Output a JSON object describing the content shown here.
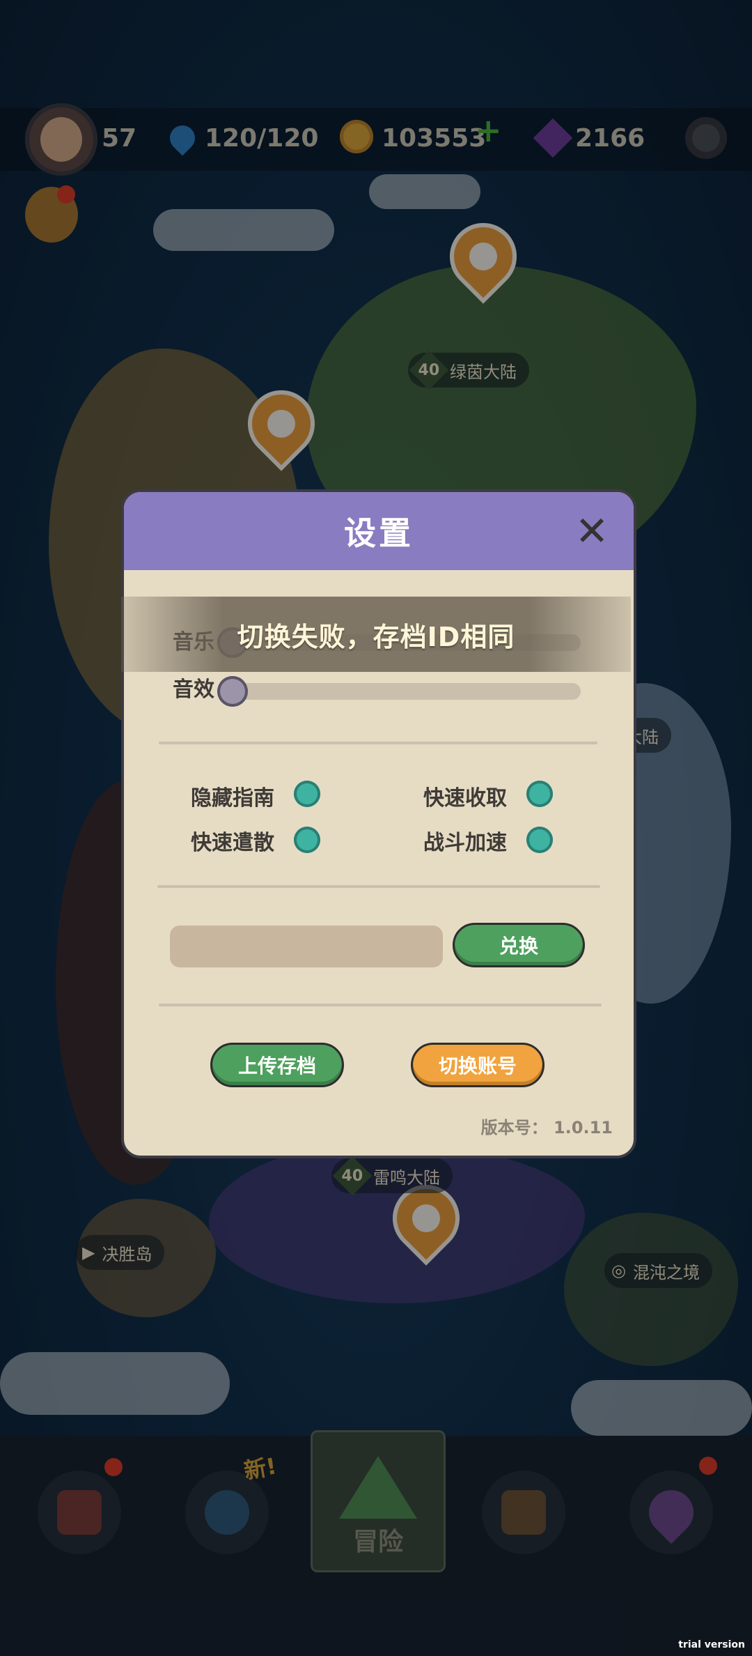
{
  "hud": {
    "level": "57",
    "energy": "120/120",
    "coins": "103553",
    "gems": "2166"
  },
  "map": {
    "labels": [
      {
        "level": "40",
        "name": "绿茵大陆"
      },
      {
        "level": "40",
        "name": "雷鸣大陆"
      },
      {
        "name": "决胜岛"
      },
      {
        "name": "混沌之境"
      },
      {
        "name": "大陆"
      }
    ]
  },
  "dialog": {
    "title": "设置",
    "music_label": "音乐",
    "sfx_label": "音效",
    "toggles": [
      {
        "label": "隐藏指南"
      },
      {
        "label": "快速收取"
      },
      {
        "label": "快速遣散"
      },
      {
        "label": "战斗加速"
      }
    ],
    "redeem_input_value": "",
    "redeem_button": "兑换",
    "upload_button": "上传存档",
    "switch_button": "切换账号",
    "version_text": "版本号： 1.0.11"
  },
  "toast": "切换失败，存档ID相同",
  "bottom_nav": {
    "active_label": "冒险",
    "new_badge": "新!"
  },
  "watermark": "trial version"
}
